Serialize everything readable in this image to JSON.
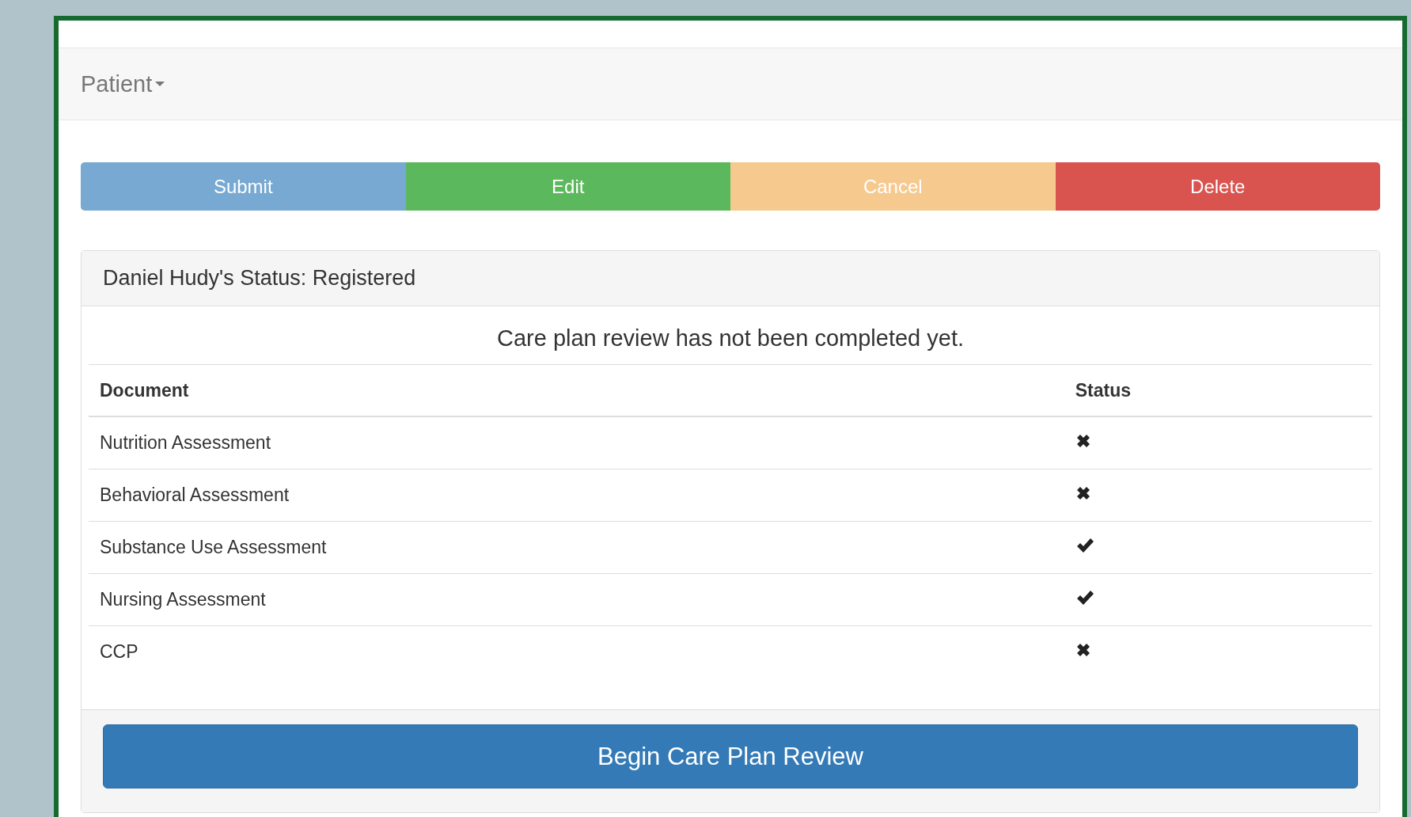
{
  "navbar": {
    "menu": "Patient"
  },
  "actions": [
    {
      "label": "Submit",
      "kind": "primary"
    },
    {
      "label": "Edit",
      "kind": "success"
    },
    {
      "label": "Cancel",
      "kind": "warning"
    },
    {
      "label": "Delete",
      "kind": "danger"
    }
  ],
  "panel": {
    "title": "Daniel Hudy's Status: Registered",
    "message": "Care plan review has not been completed yet.",
    "table": {
      "columns": [
        "Document",
        "Status"
      ],
      "rows": [
        {
          "document": "Nutrition Assessment",
          "done": false
        },
        {
          "document": "Behavioral Assessment",
          "done": false
        },
        {
          "document": "Substance Use Assessment",
          "done": true
        },
        {
          "document": "Nursing Assessment",
          "done": true
        },
        {
          "document": "CCP",
          "done": false
        }
      ]
    },
    "button": "Begin Care Plan Review"
  }
}
